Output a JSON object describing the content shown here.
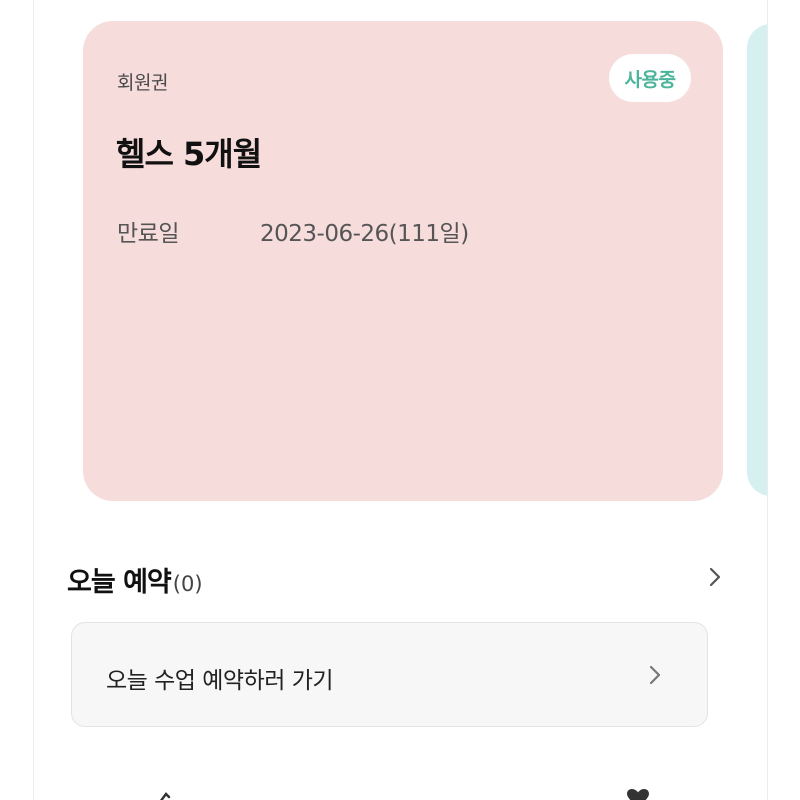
{
  "pass_card": {
    "kind_label": "회원권",
    "status_badge": "사용중",
    "title": "헬스 5개월",
    "expiry_label": "만료일",
    "expiry_value": "2023-06-26(111일)",
    "background_color": "#f7dcdc",
    "status_color": "#4cb49a"
  },
  "next_card": {
    "background_color": "#d6eff1"
  },
  "today_reservations": {
    "title": "오늘 예약",
    "count": "(0)",
    "chevron_icon": "chevron-right-icon"
  },
  "reserve_button": {
    "label": "오늘 수업 예약하러 가기",
    "chevron_icon": "chevron-right-icon"
  },
  "bottom_peek": {
    "left_icon": "partial-icon",
    "right_icon": "heart-icon"
  }
}
